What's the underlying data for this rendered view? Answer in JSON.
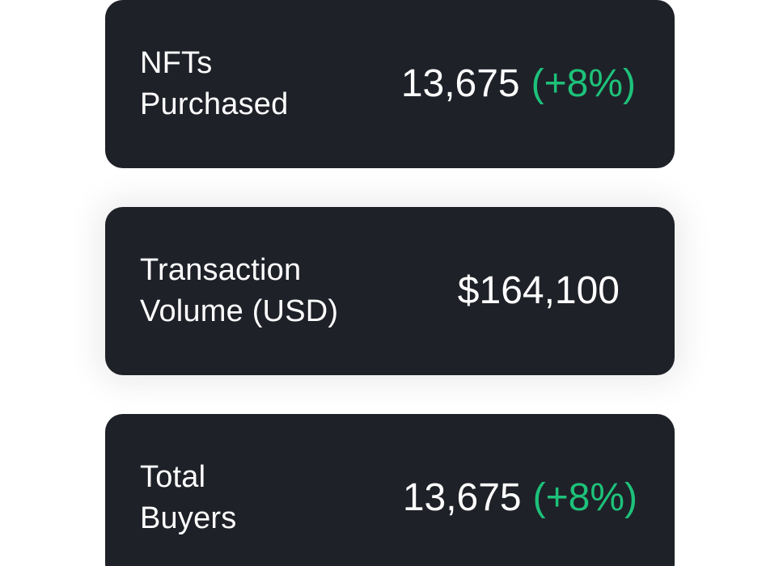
{
  "colors": {
    "card_background": "#1f2128",
    "text": "#ffffff",
    "positive_delta": "#1dc27a",
    "page_background": "#ffffff"
  },
  "cards": [
    {
      "label_line1": "NFTs",
      "label_line2": "Purchased",
      "value": "13,675",
      "delta": "(+8%)"
    },
    {
      "label_line1": "Transaction",
      "label_line2": "Volume (USD)",
      "value": "$164,100"
    },
    {
      "label_line1": "Total",
      "label_line2": "Buyers",
      "value": "13,675",
      "delta": "(+8%)"
    }
  ]
}
